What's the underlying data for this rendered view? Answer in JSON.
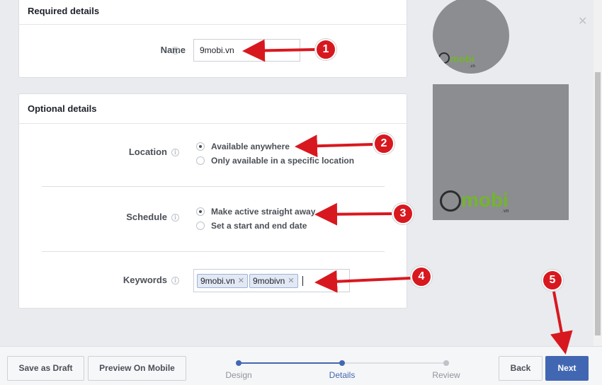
{
  "required_card": {
    "title": "Required details",
    "name_label": "Name",
    "name_value": "9mobi.vn"
  },
  "optional_card": {
    "title": "Optional details",
    "location": {
      "label": "Location",
      "options": [
        "Available anywhere",
        "Only available in a specific location"
      ],
      "selected": "Available anywhere"
    },
    "schedule": {
      "label": "Schedule",
      "options": [
        "Make active straight away",
        "Set a start and end date"
      ],
      "selected": "Make active straight away"
    },
    "keywords": {
      "label": "Keywords",
      "tokens": [
        "9mobi.vn",
        "9mobivn"
      ]
    }
  },
  "preview": {
    "logo_text": "mobi",
    "logo_suffix": ".vn"
  },
  "footer": {
    "save_draft": "Save as Draft",
    "preview_mobile": "Preview On Mobile",
    "steps": [
      "Design",
      "Details",
      "Review"
    ],
    "active_step": "Details",
    "back": "Back",
    "next": "Next"
  },
  "annotations": [
    "1",
    "2",
    "3",
    "4",
    "5"
  ],
  "colors": {
    "accent": "#4267b2",
    "annotation_red": "#d8181f",
    "background": "#e9ebee",
    "logo_green": "#74b42e"
  },
  "icons": {
    "info": "info-icon",
    "close": "close-icon",
    "token_remove": "remove-icon"
  }
}
